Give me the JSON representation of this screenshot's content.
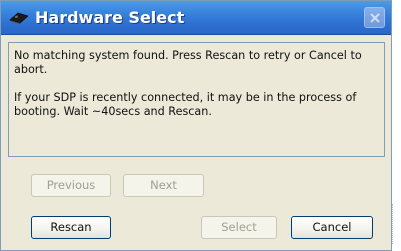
{
  "window": {
    "title": "Hardware Select",
    "icon": "board-icon"
  },
  "message": {
    "line1": "No matching system found. Press Rescan to retry or Cancel to abort.",
    "line2": "If your SDP is recently connected, it may be in the process of booting. Wait ~40secs and Rescan."
  },
  "nav": {
    "previous_label": "Previous",
    "next_label": "Next"
  },
  "actions": {
    "rescan_label": "Rescan",
    "select_label": "Select",
    "cancel_label": "Cancel"
  },
  "colors": {
    "titlebar": "#2e6fd1",
    "dialog_bg": "#ece9d8"
  }
}
